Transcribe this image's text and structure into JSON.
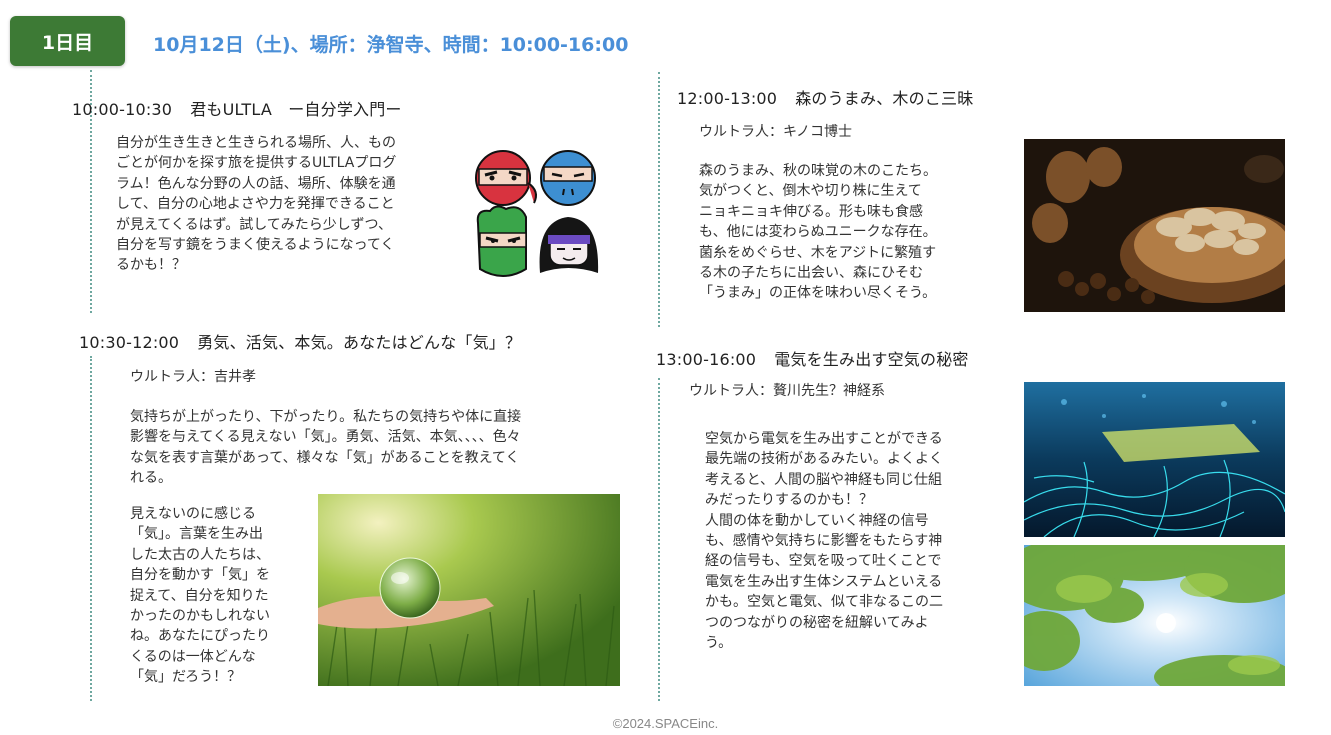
{
  "header": {
    "day_badge": "1日目",
    "info": "10月12日（土)、場所：浄智寺、時間：10:00-16:00"
  },
  "sessions": [
    {
      "time": "10:00-10:30",
      "title": "君もULTLA　ー自分学入門ー",
      "presenter": "",
      "body": "自分が生き生きと生きられる場所、人、もの\nごとが何かを探す旅を提供するULTLAプログ\nラム！色んな分野の人の話、場所、体験を通\nして、自分の心地よさや力を発揮できること\nが見えてくるはず。試してみたら少しずつ、\n自分を写す鏡をうまく使えるようになってく\nるかも！？"
    },
    {
      "time": "10:30-12:00",
      "title": "勇気、活気、本気。あなたはどんな「気」？",
      "presenter": "ウルトラ人：吉井孝",
      "body": "気持ちが上がったり、下がったり。私たちの気持ちや体に直接\n影響を与えてくる見えない「気」。勇気、活気、本気、、、、色々\nな気を表す言葉があって、様々な「気」があることを教えてく\nれる。",
      "body2": "見えないのに感じる\n「気」。言葉を生み出\nした太古の人たちは、\n自分を動かす「気」を\n捉えて、自分を知りた\nかったのかもしれない\nね。あなたにぴったり\nくるのは一体どんな\n「気」だろう！？"
    },
    {
      "time": "12:00-13:00",
      "title": "森のうまみ、木のこ三昧",
      "presenter": "ウルトラ人：キノコ博士",
      "body": "森のうまみ、秋の味覚の木のこたち。\n気がつくと、倒木や切り株に生えて\nニョキニョキ伸びる。形も味も食感\nも、他には変わらぬユニークな存在。\n菌糸をめぐらせ、木をアジトに繁殖す\nる木の子たちに出会い、森にひそむ\n「うまみ」の正体を味わい尽くそう。"
    },
    {
      "time": "13:00-16:00",
      "title": "電気を生み出す空気の秘密",
      "presenter": "ウルトラ人：贅川先生？神経系",
      "body": "空気から電気を生み出すことができる\n最先端の技術があるみたい。よくよく\n考えると、人間の脳や神経も同じ仕組\nみだったりするのかも！？\n人間の体を動かしていく神経の信号\nも、感情や気持ちに影響をもたらす神\n経の信号も、空気を吸って吐くことで\n電気を生み出す生体システムといえる\nかも。空気と電気、似て非なるこの二\nつのつながりの秘密を紐解いてみよ\nう。"
    }
  ],
  "footer": "©2024.SPACEinc.",
  "colors": {
    "badge_green": "#3d7a35",
    "header_blue": "#4a8fd8",
    "dotted_line": "#6fa8a0"
  },
  "images": [
    "ninja-characters-illustration",
    "mushrooms-chestnuts-photo",
    "glass-globe-in-hand-grass-photo",
    "glowing-neural-network-photo",
    "tree-canopy-sunlight-photo"
  ]
}
